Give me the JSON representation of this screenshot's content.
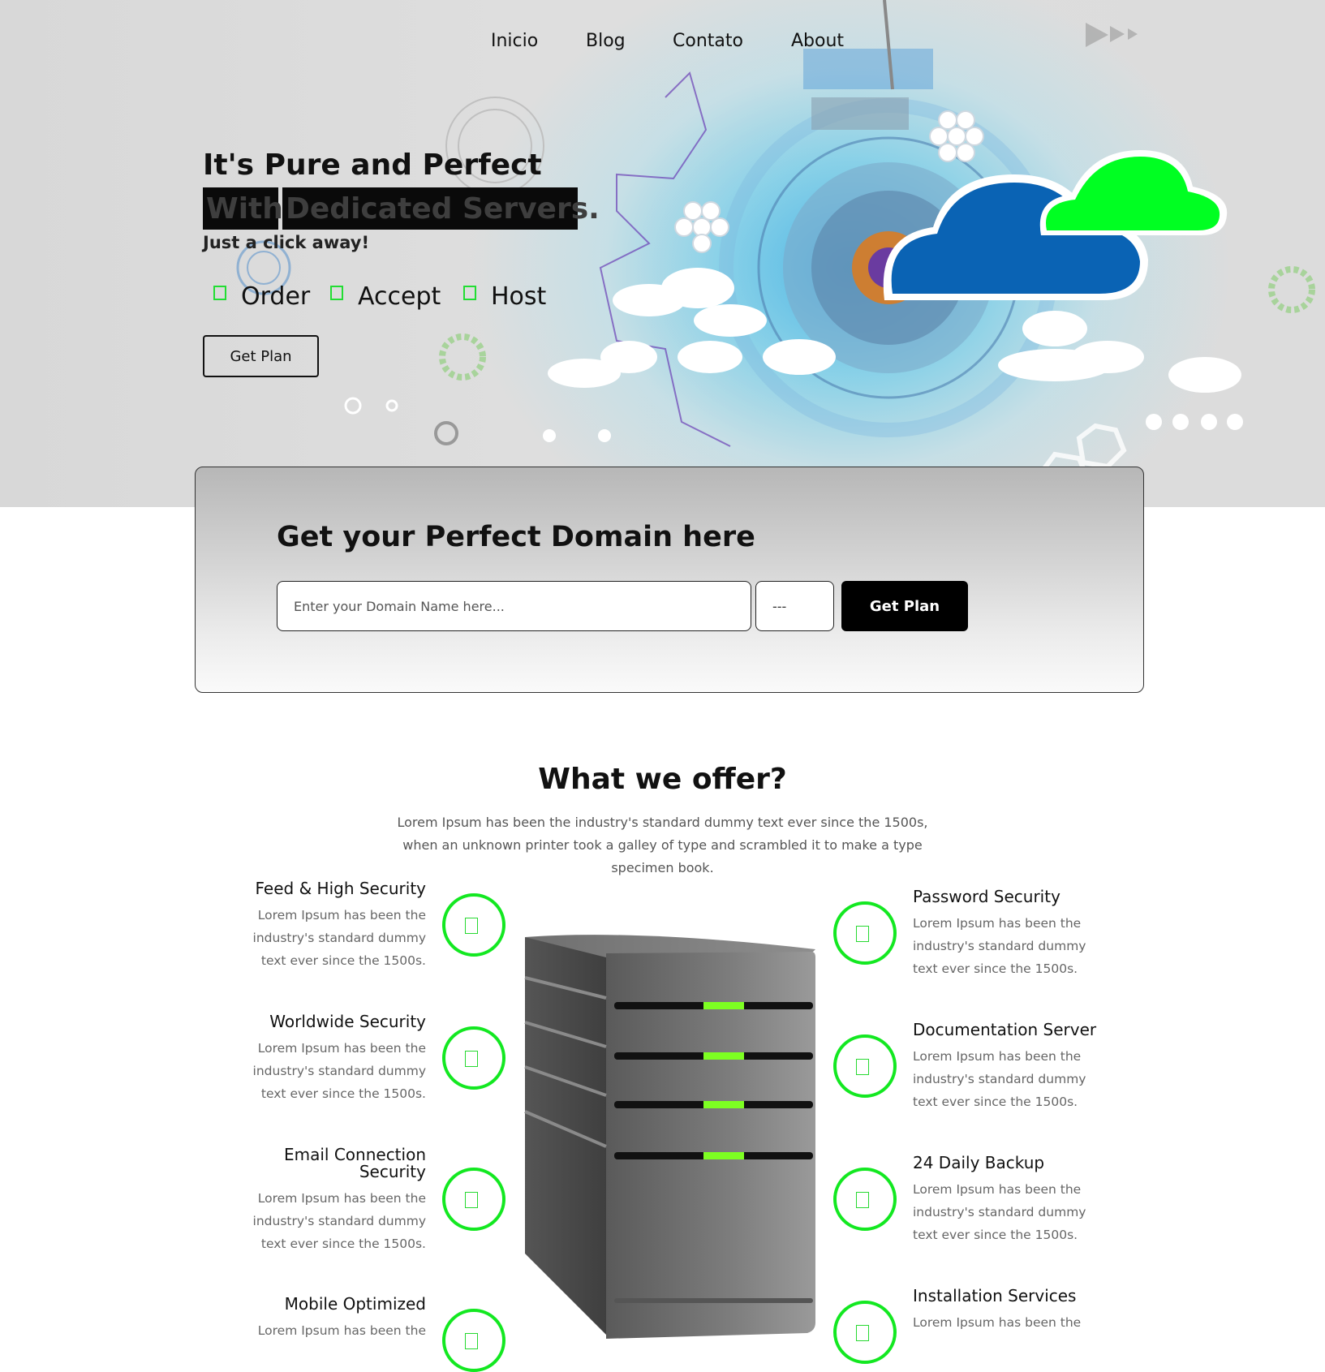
{
  "nav": {
    "items": [
      "Inicio",
      "Blog",
      "Contato",
      "About"
    ]
  },
  "hero": {
    "title_line1": "It's Pure and Perfect",
    "title_highlight_word1": "With",
    "title_highlight_word2": "Dedicated Servers.",
    "subtitle": "Just a click away!",
    "features": [
      {
        "label": "Order",
        "icon": "checkbox-icon"
      },
      {
        "label": "Accept",
        "icon": "checkbox-icon"
      },
      {
        "label": "Host",
        "icon": "checkbox-icon"
      }
    ],
    "button_label": "Get Plan"
  },
  "domain": {
    "title": "Get your Perfect Domain here",
    "input_placeholder": "Enter your Domain Name here...",
    "select_value": "---",
    "button_label": "Get Plan"
  },
  "offer": {
    "title": "What we offer?",
    "description": "Lorem Ipsum has been the industry's standard dummy text ever since the 1500s, when an unknown printer took a galley of type and scrambled it to make a type specimen book.",
    "services_left": [
      {
        "title": "Feed & High Security",
        "text": "Lorem Ipsum has been the industry's standard dummy text ever since the 1500s."
      },
      {
        "title": "Worldwide Security",
        "text": "Lorem Ipsum has been the industry's standard dummy text ever since the 1500s."
      },
      {
        "title": "Email Connection Security",
        "text": "Lorem Ipsum has been the industry's standard dummy text ever since the 1500s."
      },
      {
        "title": "Mobile Optimized",
        "text": "Lorem Ipsum has been the"
      }
    ],
    "services_right": [
      {
        "title": "Password Security",
        "text": "Lorem Ipsum has been the industry's standard dummy text ever since the 1500s."
      },
      {
        "title": "Documentation Server",
        "text": "Lorem Ipsum has been the industry's standard dummy text ever since the 1500s."
      },
      {
        "title": "24 Daily Backup",
        "text": "Lorem Ipsum has been the industry's standard dummy text ever since the 1500s."
      },
      {
        "title": "Installation Services",
        "text": "Lorem Ipsum has been the"
      }
    ]
  },
  "colors": {
    "accent_green": "#13e821",
    "cloud_blue": "#0a63b4",
    "cloud_green": "#00ff22",
    "button_black": "#000000"
  }
}
